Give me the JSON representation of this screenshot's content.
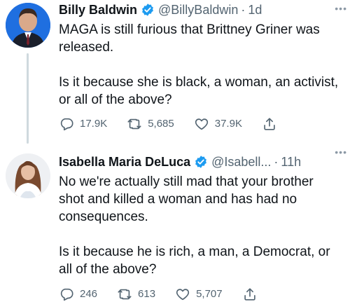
{
  "tweets": [
    {
      "name": "Billy Baldwin",
      "handle": "@BillyBaldwin",
      "separator": "·",
      "time": "1d",
      "text": "MAGA is still furious that Brittney Griner was released.\n\nIs it because she is black, a woman, an activist, or all of the above?",
      "replies": "17.9K",
      "retweets": "5,685",
      "likes": "37.9K",
      "more": "•••"
    },
    {
      "name": "Isabella Maria DeLuca",
      "handle": "@Isabell...",
      "separator": "·",
      "time": "11h",
      "text": "No we're actually still mad that your brother shot and killed a woman and has had no consequences.\n\nIs it because he is rich, a man, a Democrat, or all of the above?",
      "replies": "246",
      "retweets": "613",
      "likes": "5,707",
      "more": "•••"
    }
  ],
  "colors": {
    "text": "#0f1419",
    "secondary": "#536471",
    "verified": "#1d9bf0",
    "thread_line": "#cfd9de"
  }
}
